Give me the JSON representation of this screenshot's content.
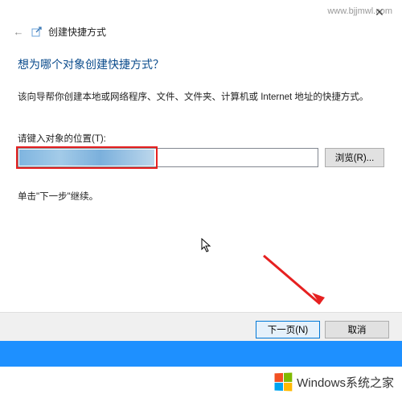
{
  "titlebar": {
    "close": "✕"
  },
  "header": {
    "back_glyph": "←",
    "title": "创建快捷方式"
  },
  "main": {
    "heading": "想为哪个对象创建快捷方式？",
    "description": "该向导帮你创建本地或网络程序、文件、文件夹、计算机或 Internet 地址的快捷方式。",
    "location_label": "请键入对象的位置(T):",
    "location_value": "",
    "browse_label": "浏览(R)...",
    "instruction": "单击\"下一步\"继续。"
  },
  "buttons": {
    "next": "下一页(N)",
    "cancel": "取消"
  },
  "watermark": {
    "brand_prefix": "Windows",
    "brand_suffix": "系统之家",
    "url": "www.bjjmwl.com"
  }
}
